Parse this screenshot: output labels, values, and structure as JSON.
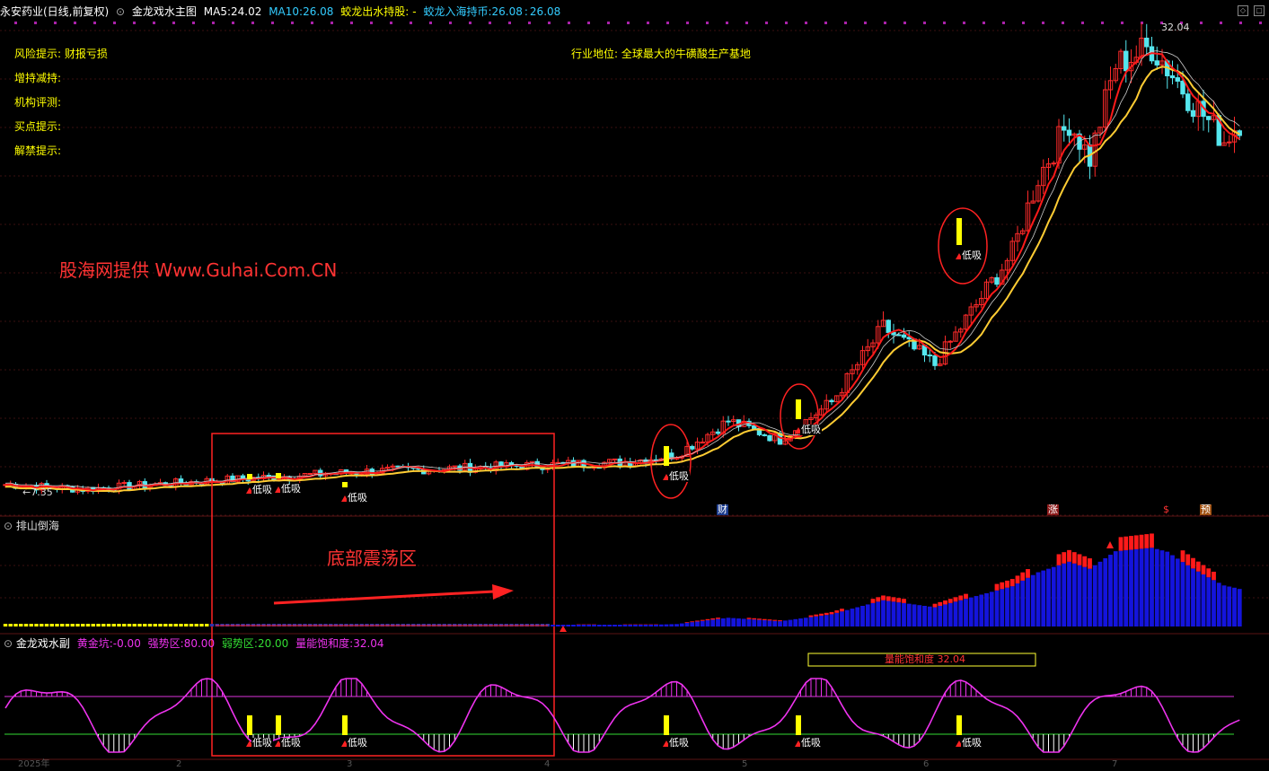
{
  "header": {
    "stock": "永安药业(日线,前复权)",
    "indicator": "金龙戏水主图",
    "ma5_label": "MA5:",
    "ma5": "24.02",
    "ma10_label": "MA10:",
    "ma10": "26.08",
    "f1_label": "蛟龙出水持股:",
    "f1": "-",
    "f2_label": "蛟龙入海持币:",
    "f2": "26.08",
    "f2b": "26.08"
  },
  "info": {
    "risk": "风险提示: 财报亏损",
    "hold": "增持减持:",
    "inst": "机构评测:",
    "buy": "买点提示:",
    "unlock": "解禁提示:",
    "industry": "行业地位: 全球最大的牛磺酸生产基地"
  },
  "watermark": "股海网提供 Www.Guhai.Com.CN",
  "annotation": "底部震荡区",
  "price": {
    "high_label": "32.04",
    "low_label": "←7.35"
  },
  "signal_label": "低吸",
  "badges": [
    "财",
    "涨",
    "$",
    "预"
  ],
  "panel2": {
    "title": "排山倒海"
  },
  "panel3": {
    "title": "金龙戏水副",
    "gold_label": "黄金坑:",
    "gold": "-0.00",
    "strong_label": "强势区:",
    "strong": "80.00",
    "weak_label": "弱势区:",
    "weak": "20.00",
    "energy_label": "量能饱和度:",
    "energy": "32.04",
    "box_text": "量能饱和度 32.04"
  },
  "axis": {
    "year": "2025年",
    "months": [
      "2",
      "3",
      "4",
      "5",
      "6",
      "7"
    ]
  },
  "colors": {
    "up": "#ff2a2a",
    "down": "#55e6ee",
    "ma_red": "#ff1a1a",
    "ma_yellow": "#ffcc33",
    "blue_bar": "#1414dc",
    "red_bar": "#ff1a1a",
    "osc": "#ee33ee",
    "weak_line": "#33dd33",
    "strong_line": "#dd33dd",
    "signal": "#ffff00",
    "label_yellow": "#ffff00",
    "label_blue": "#33ccff",
    "watermark": "#ff3333"
  }
}
